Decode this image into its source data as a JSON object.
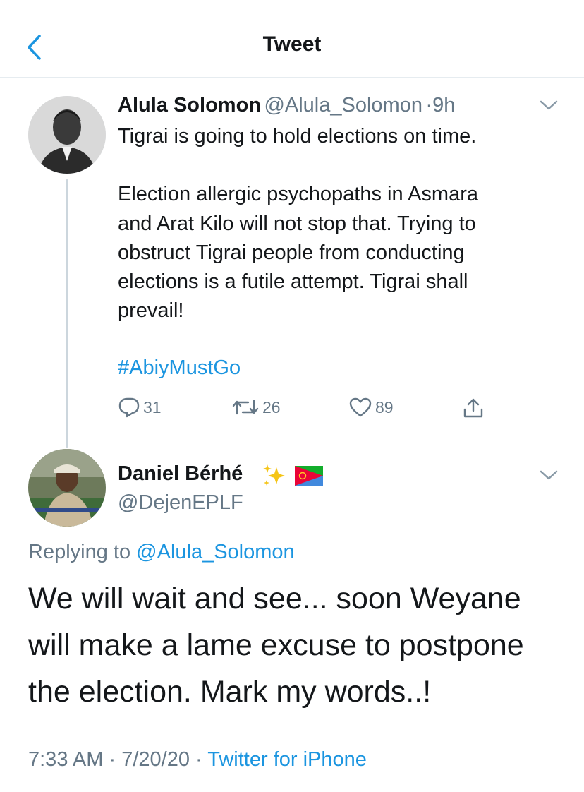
{
  "nav": {
    "title": "Tweet"
  },
  "tweet1": {
    "name": "Alula Solomon",
    "handle": "@Alula_Solomon",
    "sep": "·",
    "time": "9h",
    "text_lines": [
      "Tigrai is going to hold elections on time.",
      "Election allergic psychopaths in Asmara",
      "and Arat Kilo will not stop that. Trying to",
      "obstruct Tigrai people from conducting",
      "elections is a futile attempt. Tigrai shall",
      "prevail!"
    ],
    "hashtag": "#AbiyMustGo",
    "replies": "31",
    "retweets": "26",
    "likes": "89"
  },
  "tweet2": {
    "name": "Daniel Bérhé",
    "emoji_icons": [
      "sparkles-icon",
      "eritrea-flag-icon"
    ],
    "handle": "@DejenEPLF",
    "replying_label": "Replying to",
    "replying_handle": "@Alula_Solomon",
    "text_lines": [
      "We will wait and see... soon Weyane",
      "will make a lame excuse to postpone",
      "the election. Mark my words..!"
    ],
    "time": "7:33 AM",
    "date": "7/20/20",
    "dot": "·",
    "source": "Twitter for iPhone"
  },
  "colors": {
    "link": "#1b95e0",
    "muted": "#657786",
    "text": "#14171a"
  }
}
